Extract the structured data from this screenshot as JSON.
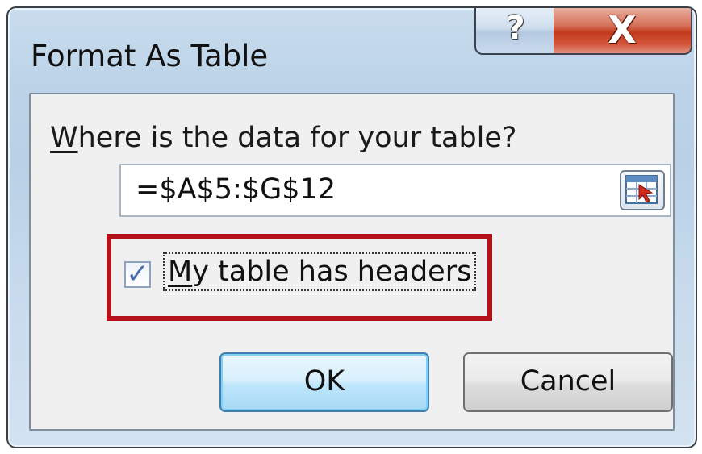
{
  "window": {
    "title": "Format As Table"
  },
  "caption_buttons": {
    "help_glyph": "?",
    "close_glyph": "X"
  },
  "form": {
    "prompt_accel": "W",
    "prompt_rest": "here is the data for your table?",
    "range_value": "=$A$5:$G$12",
    "collapse_icon": "range-selector-icon",
    "checkbox": {
      "checked": true,
      "label_accel": "M",
      "label_rest": "y table has headers"
    }
  },
  "buttons": {
    "ok": "OK",
    "cancel": "Cancel"
  },
  "colors": {
    "highlight": "#b3121a",
    "close_button": "#c1391c",
    "ok_border": "#3c7fb1"
  }
}
